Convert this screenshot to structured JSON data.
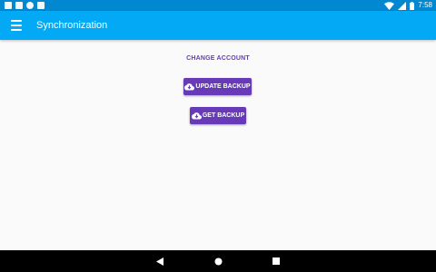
{
  "status_bar": {
    "time": "7:58",
    "notification_icons": [
      "app-notification-icon",
      "mail-icon",
      "sync-icon",
      "clipboard-icon"
    ],
    "system_icons": [
      "wifi-icon",
      "cell-signal-icon",
      "battery-icon"
    ]
  },
  "app_bar": {
    "title": "Synchronization",
    "menu_icon": "menu-icon",
    "color": "#03a9f4",
    "status_color": "#0288d1"
  },
  "main": {
    "change_account_label": "CHANGE ACCOUNT",
    "update_backup_label": "UPDATE BACKUP",
    "get_backup_label": "GET BACKUP",
    "button_icon": "cloud-download-icon",
    "accent_color": "#673ab7"
  },
  "nav_bar": {
    "back_icon": "back-triangle-icon",
    "home_icon": "home-circle-icon",
    "recents_icon": "recents-square-icon"
  }
}
